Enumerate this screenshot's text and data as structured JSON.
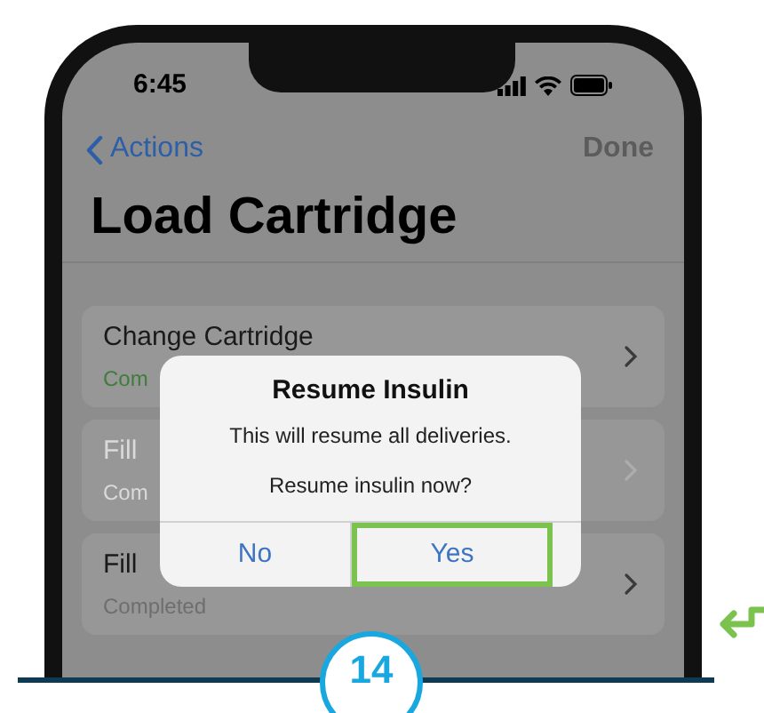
{
  "status_bar": {
    "time": "6:45"
  },
  "nav": {
    "back": "Actions",
    "done": "Done"
  },
  "title": "Load Cartridge",
  "rows": [
    {
      "title": "Change Cartridge",
      "status": "Com",
      "color": "#3f7d3c",
      "disabled": false
    },
    {
      "title": "Fill",
      "status": "Com",
      "color": "#dadada",
      "disabled": true
    },
    {
      "title": "Fill",
      "status": "Completed",
      "color": "#6e6e6e",
      "disabled": false
    }
  ],
  "dialog": {
    "title": "Resume Insulin",
    "message": "This will resume all deliveries.",
    "question": "Resume insulin now?",
    "buttons": [
      {
        "label": "No",
        "selected": false
      },
      {
        "label": "Yes",
        "selected": true
      }
    ]
  },
  "step_badge": "14"
}
